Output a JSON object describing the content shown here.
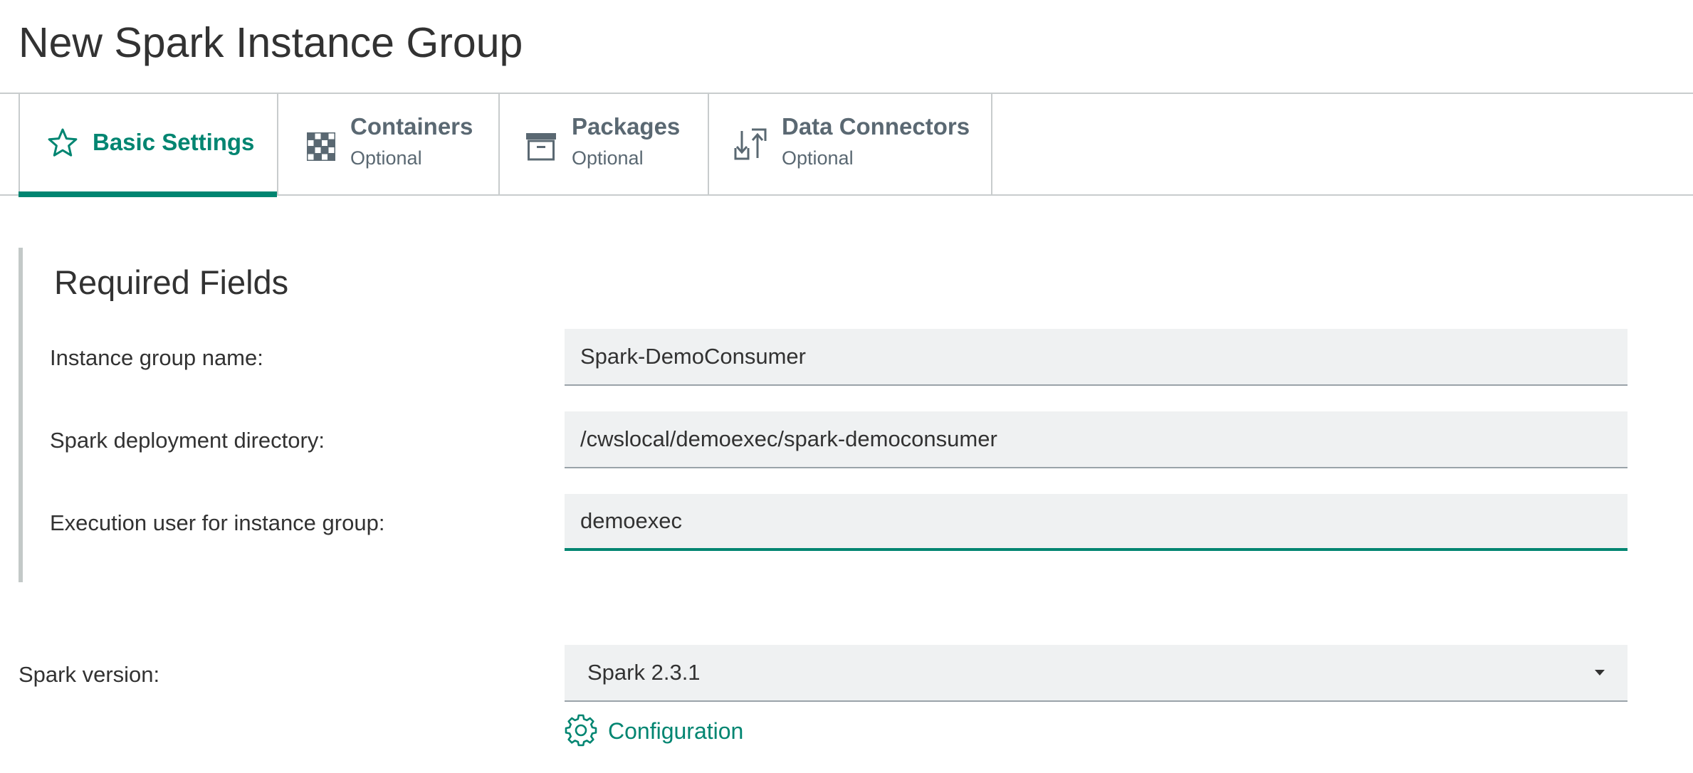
{
  "page": {
    "title": "New Spark Instance Group"
  },
  "tabs": [
    {
      "label": "Basic Settings",
      "icon": "star-icon",
      "active": true
    },
    {
      "label": "Containers",
      "sublabel": "Optional",
      "icon": "grid-icon",
      "active": false
    },
    {
      "label": "Packages",
      "sublabel": "Optional",
      "icon": "archive-box-icon",
      "active": false
    },
    {
      "label": "Data Connectors",
      "sublabel": "Optional",
      "icon": "transfer-arrows-icon",
      "active": false
    }
  ],
  "required_fields": {
    "title": "Required Fields",
    "instance_group_name": {
      "label": "Instance group name:",
      "value": "Spark-DemoConsumer"
    },
    "deployment_directory": {
      "label": "Spark deployment directory:",
      "value": "/cwslocal/demoexec/spark-democonsumer"
    },
    "execution_user": {
      "label": "Execution user for instance group:",
      "value": "demoexec",
      "focused": true
    }
  },
  "spark_version": {
    "label": "Spark version:",
    "selected": "Spark 2.3.1"
  },
  "configuration_link": {
    "label": "Configuration",
    "icon": "gear-icon"
  },
  "colors": {
    "accent": "#008571",
    "text": "#323232",
    "muted": "#5a6872",
    "input_bg": "#eff1f2",
    "border": "#c8cccd"
  }
}
